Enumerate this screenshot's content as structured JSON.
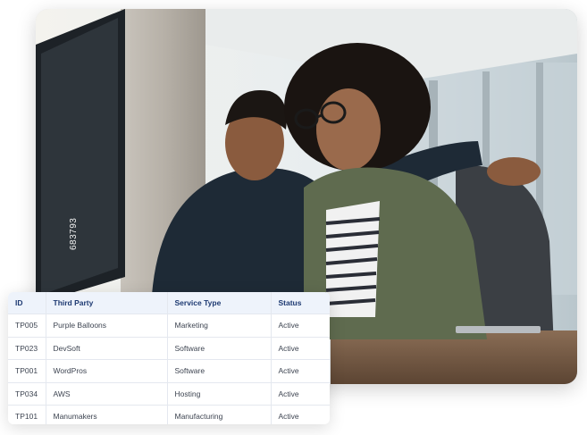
{
  "photo": {
    "stock_id": "683793",
    "alt_icon": "photo-two-people-at-monitor"
  },
  "table": {
    "headers": [
      "ID",
      "Third Party",
      "Service Type",
      "Status"
    ],
    "rows": [
      {
        "id": "TP005",
        "party": "Purple Balloons",
        "service": "Marketing",
        "status": "Active"
      },
      {
        "id": "TP023",
        "party": "DevSoft",
        "service": "Software",
        "status": "Active"
      },
      {
        "id": "TP001",
        "party": "WordPros",
        "service": "Software",
        "status": "Active"
      },
      {
        "id": "TP034",
        "party": "AWS",
        "service": "Hosting",
        "status": "Active"
      },
      {
        "id": "TP101",
        "party": "Manumakers",
        "service": "Manufacturing",
        "status": "Active"
      }
    ]
  },
  "colors": {
    "header_bg": "#eef3fb",
    "header_text": "#1e3a72",
    "cell_text": "#3d4451"
  }
}
